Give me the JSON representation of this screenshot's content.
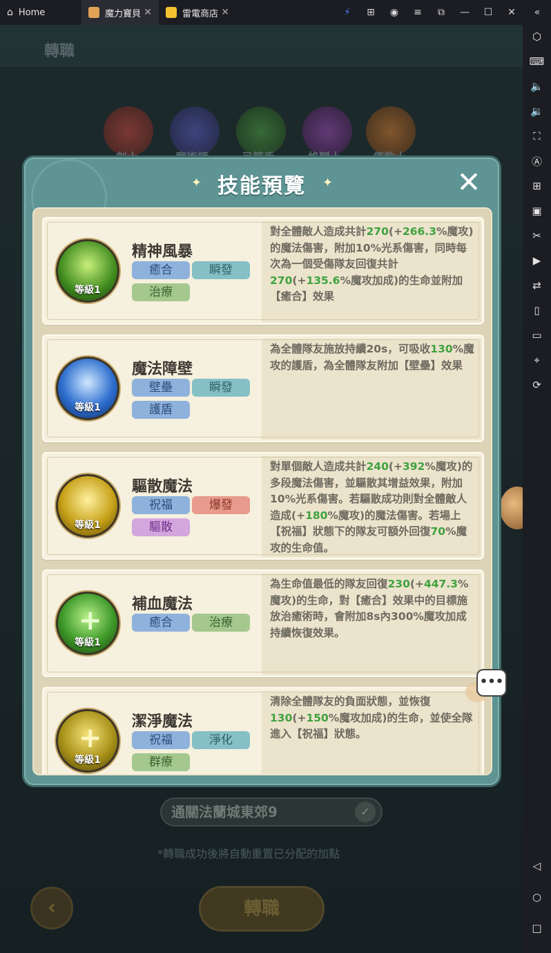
{
  "topbar": {
    "home_label": "Home",
    "tabs": [
      {
        "label": "魔力寶貝",
        "close": "✕"
      },
      {
        "label": "雷電商店",
        "close": "✕"
      }
    ],
    "home_close": "✕"
  },
  "background": {
    "page_title": "轉職",
    "classes": [
      "劍士",
      "魔術師",
      "弓箭手",
      "格鬥士",
      "傳教士"
    ],
    "condition_text": "通關法蘭城東郊9",
    "note": "*轉職成功後將自動重置已分配的加點",
    "back_icon": "‹",
    "change_button": "轉職",
    "check_icon": "✓"
  },
  "dialog": {
    "title": "技能預覽",
    "close_icon": "✕",
    "star": "✦"
  },
  "skills": [
    {
      "name": "精神風暴",
      "level": "等級1",
      "tags": [
        "癒合",
        "瞬發",
        "治療"
      ],
      "desc_parts": [
        {
          "t": "對全體敵人造成共計"
        },
        {
          "t": "270",
          "hl": true
        },
        {
          "t": "(+"
        },
        {
          "t": "266.3",
          "hl": true
        },
        {
          "t": "%魔攻)的魔法傷害，附加10%光系傷害，同時每次為一個受傷隊友回復共計"
        },
        {
          "t": "270",
          "hl": true
        },
        {
          "t": "(+"
        },
        {
          "t": "135.6",
          "hl": true
        },
        {
          "t": "%魔攻加成)的生命並附加【癒合】效果"
        }
      ]
    },
    {
      "name": "魔法障壁",
      "level": "等級1",
      "tags": [
        "壁壘",
        "瞬發",
        "護盾"
      ],
      "desc_parts": [
        {
          "t": "為全體隊友施放持續20s，可吸收"
        },
        {
          "t": "130",
          "hl": true
        },
        {
          "t": "%魔攻的護盾，為全體隊友附加【壁壘】效果"
        }
      ]
    },
    {
      "name": "驅散魔法",
      "level": "等級1",
      "tags": [
        "祝福",
        "爆發",
        "驅散"
      ],
      "desc_parts": [
        {
          "t": "對單個敵人造成共計"
        },
        {
          "t": "240",
          "hl": true
        },
        {
          "t": "(+"
        },
        {
          "t": "392",
          "hl": true
        },
        {
          "t": "%魔攻)的多段魔法傷害，並驅散其增益效果，附加10%光系傷害。若驅散成功則對全體敵人造成(+"
        },
        {
          "t": "180",
          "hl": true
        },
        {
          "t": "%魔攻)的魔法傷害。若場上【祝福】狀態下的隊友可額外回復"
        },
        {
          "t": "70",
          "hl": true
        },
        {
          "t": "%魔攻的生命值。"
        }
      ]
    },
    {
      "name": "補血魔法",
      "level": "等級1",
      "tags": [
        "癒合",
        "治療"
      ],
      "desc_parts": [
        {
          "t": "為生命值最低的隊友回復"
        },
        {
          "t": "230",
          "hl": true
        },
        {
          "t": "(+"
        },
        {
          "t": "447.3",
          "hl": true
        },
        {
          "t": "%魔攻)的生命，對【癒合】效果中的目標施放治癒術時，會附加8s內300%魔攻加成持續恢復效果。"
        }
      ]
    },
    {
      "name": "潔淨魔法",
      "level": "等級1",
      "tags": [
        "祝福",
        "淨化",
        "群療"
      ],
      "desc_parts": [
        {
          "t": "清除全體隊友的負面狀態，並恢復"
        },
        {
          "t": "130",
          "hl": true
        },
        {
          "t": "(+"
        },
        {
          "t": "150",
          "hl": true
        },
        {
          "t": "%魔攻加成)的生命，並使全隊進入【祝福】狀態。"
        }
      ]
    }
  ],
  "chat_bubble": "•••",
  "colors": {
    "highlight": "#3fa23f",
    "dialog_frame": "#5e9494",
    "card_bg": "#f6f0de"
  }
}
